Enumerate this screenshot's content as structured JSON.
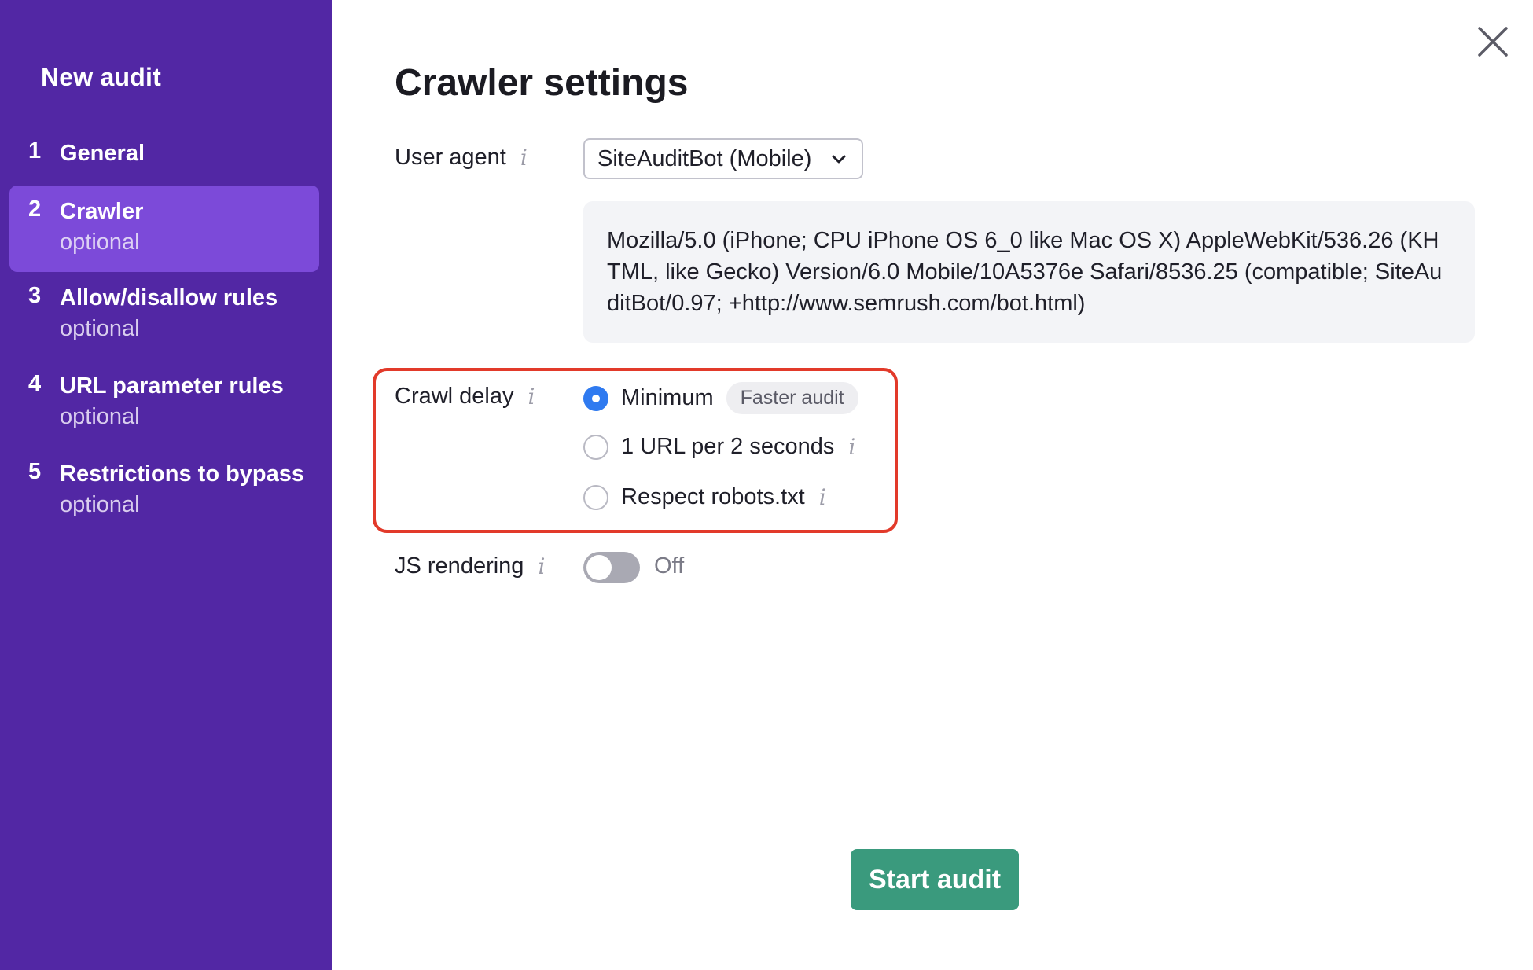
{
  "sidebar": {
    "title": "New audit",
    "steps": [
      {
        "num": "1",
        "label": "General",
        "sub": ""
      },
      {
        "num": "2",
        "label": "Crawler",
        "sub": "optional"
      },
      {
        "num": "3",
        "label": "Allow/disallow rules",
        "sub": "optional"
      },
      {
        "num": "4",
        "label": "URL parameter rules",
        "sub": "optional"
      },
      {
        "num": "5",
        "label": "Restrictions to bypass",
        "sub": "optional"
      }
    ]
  },
  "main": {
    "title": "Crawler settings",
    "user_agent": {
      "label": "User agent",
      "info": "i",
      "selected": "SiteAuditBot (Mobile)",
      "string": "Mozilla/5.0 (iPhone; CPU iPhone OS 6_0 like Mac OS X) AppleWebKit/536.26 (KHTML, like Gecko) Version/6.0 Mobile/10A5376e Safari/8536.25 (compatible; SiteAuditBot/0.97; +http://www.semrush.com/bot.html)"
    },
    "crawl_delay": {
      "label": "Crawl delay",
      "info": "i",
      "options": [
        {
          "label": "Minimum",
          "badge": "Faster audit",
          "checked": true
        },
        {
          "label": "1 URL per 2 seconds",
          "checked": false
        },
        {
          "label": "Respect robots.txt",
          "checked": false
        }
      ]
    },
    "js_rendering": {
      "label": "JS rendering",
      "info": "i",
      "state": "Off"
    },
    "start_button": "Start audit"
  },
  "colors": {
    "sidebar_bg": "#5227a4",
    "sidebar_active": "#7c4ad9",
    "radio_checked": "#2f7af0",
    "highlight_border": "#e23a2a",
    "start_button": "#3a9a7d"
  }
}
